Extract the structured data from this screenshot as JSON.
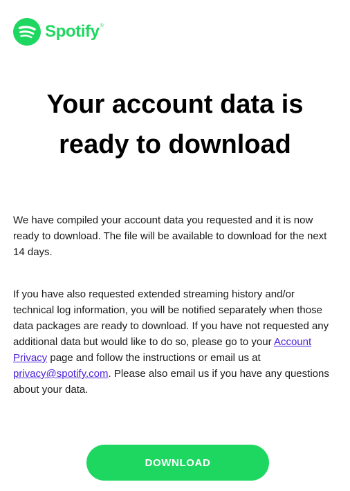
{
  "brand": {
    "name": "Spotify",
    "trademark": "®",
    "logo_icon": "spotify-logo-icon",
    "color": "#1ed760"
  },
  "headline": "Your account data is ready to download",
  "paragraph1": "We have compiled your account data you requested and it is now ready to download. The file will be available to download for the next 14 days.",
  "paragraph2": {
    "text_before_link": "If you have also requested extended streaming history and/or technical log information, you will be notified separately when those data packages are ready to download. If you have not requested any additional data but would like to do so, please go to your ",
    "account_privacy_link": "Account Privacy",
    "text_after_link": " page and follow the instructions or email us at ",
    "email_link": "privacy@spotify.com",
    "text_end": ". Please also email us if you have any questions about your data."
  },
  "download_button": {
    "label": "DOWNLOAD"
  },
  "colors": {
    "accent": "#1ed760",
    "link": "#4a1fd6",
    "button_text": "#ffffff"
  }
}
